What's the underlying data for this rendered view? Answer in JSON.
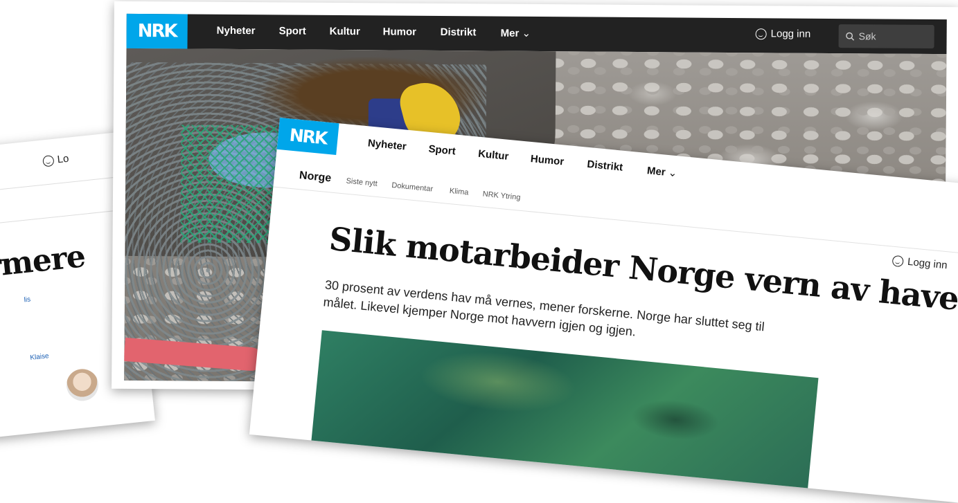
{
  "left_card": {
    "login": "Lo",
    "headline": "rmere",
    "links": [
      "lis",
      "Klaise"
    ]
  },
  "middle_card": {
    "logo": "NRK",
    "nav": [
      "Nyheter",
      "Sport",
      "Kultur",
      "Humor",
      "Distrikt",
      "Mer"
    ],
    "mer_caret": "⌄",
    "login": "Logg inn",
    "search_placeholder": "Søk",
    "search_icon": "search-icon"
  },
  "front_card": {
    "logo": "NRK",
    "nav": [
      "Nyheter",
      "Sport",
      "Kultur",
      "Humor",
      "Distrikt",
      "Mer"
    ],
    "mer_caret": "⌄",
    "section": "Norge",
    "subnav": [
      "Siste nytt",
      "Dokumentar",
      "Klima",
      "NRK Ytring"
    ],
    "login": "Logg inn",
    "headline": "Slik motarbeider Norge vern av havet",
    "lead": "30 prosent av verdens hav må vernes, mener forskerne. Norge har sluttet seg til målet. Likevel kjemper Norge mot havvern igjen og igjen."
  },
  "colors": {
    "nrk_blue": "#00a6ea",
    "navbar_dark": "#222222"
  }
}
